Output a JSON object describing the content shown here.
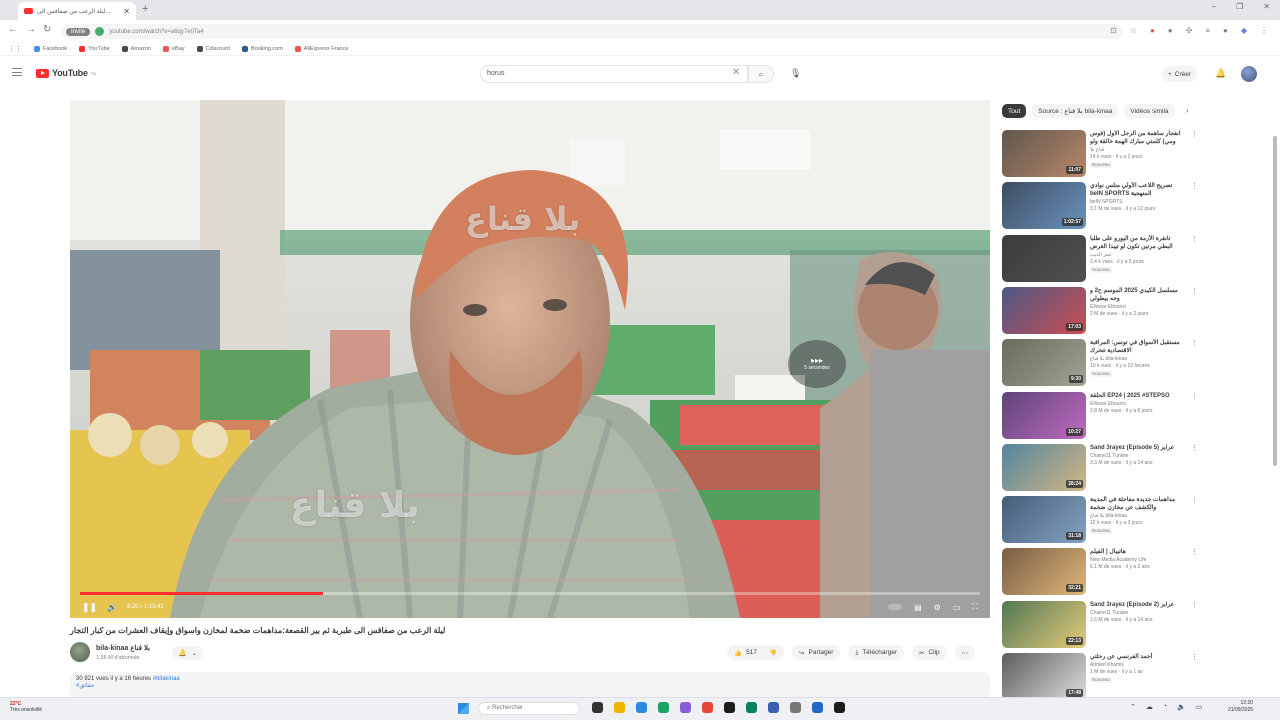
{
  "browser": {
    "tab_title": "ليلة الرعب من صفاقس الى...",
    "url": "youtube.com/watch?v=a6qy7e0Ta4",
    "incognito_badge": "Invité",
    "window_controls": [
      "–",
      "❐",
      "✕"
    ],
    "bookmarks": [
      {
        "label": "Facebook",
        "color": "#1877f2"
      },
      {
        "label": "YouTube",
        "color": "#ff0000"
      },
      {
        "label": "Amazon",
        "color": "#222222"
      },
      {
        "label": "eBay",
        "color": "#e53238"
      },
      {
        "label": "Cdiscount",
        "color": "#222222"
      },
      {
        "label": "Booking.com",
        "color": "#003580"
      },
      {
        "label": "AliExpress France",
        "color": "#e43225"
      }
    ]
  },
  "header": {
    "logo_text": "YouTube",
    "logo_region": "TN",
    "search_value": "horus",
    "create_label": "Créer"
  },
  "video": {
    "watermark": "بلا قناع",
    "time": "6:20 / 1:13:41",
    "progress": 0.27,
    "skip_label": "5 secondes",
    "title": "ليلة الرعب من صفاقس الى طبربة ثم بير القصعة:مداهمات ضخمة لمخازن واسواق وإيقاف العشرات من كبار التجار"
  },
  "channel": {
    "name": "bila-kinaa بلا قناع",
    "subscribers": "1,56 M d'abonnés"
  },
  "actions": {
    "likes": "517",
    "share": "Partager",
    "download": "Télécharger",
    "clip": "Clip"
  },
  "description": {
    "stats": "30 821 vues  il y a 16 heures",
    "hashtag1": "#bilakinaa",
    "hashtag2": "#حقائق"
  },
  "sidebar": {
    "filters": [
      "Tout",
      "Source : بلا قناع bila-kinaa",
      "Vidéos simila"
    ],
    "recommendations": [
      {
        "title": "انفجار ساهمة من الرجل الاول (فوس ومي) كلمتي مبارك الهمة خالقة ولو اتحملو...",
        "channel": "قناع بلا",
        "views": "14 k vues · il y a 2 jours",
        "badge": "Nouveau",
        "duration": "11:07",
        "bg1": "#3d3226",
        "bg2": "#a86e4a"
      },
      {
        "title": "تصريح اللاعب الأولي منلس نوادي beIN SPORTS المنهجية",
        "channel": "beIN SPORTS",
        "views": "3,1 M de vues · il y a 12 jours",
        "badge": "",
        "duration": "1:02:57",
        "bg1": "#14263d",
        "bg2": "#4a7cb3"
      },
      {
        "title": "تانقرة الأزمة من اليورو على طلبا البطي مرتين تكون لو تيبدا الغرض المنوبة",
        "channel": "عمر الديب",
        "views": "2,4 k vues · il y a 5 jours",
        "badge": "Nouveau",
        "duration": "",
        "bg1": "#111111",
        "bg2": "#2b2b2b"
      },
      {
        "title": "مسلسل الكيدي 2025 الموسم ح2 و وجه بيطولي",
        "channel": "Elhiwar Ettounsi",
        "views": "2 M de vues · il y a 2 jours",
        "badge": "",
        "duration": "17:03",
        "bg1": "#24346c",
        "bg2": "#c2272d"
      },
      {
        "title": "مستقبل الأسواق في تونس: المراقبة الاقتصادية تتحرك",
        "channel": "بلا قناع bila-kinaa",
        "views": "19 k vues · il y a 23 heures",
        "badge": "Nouveau",
        "duration": "9:30",
        "bg1": "#4a4a3a",
        "bg2": "#8d8f7d"
      },
      {
        "title": "الحلقة EP24 | 2025 #STEPSO",
        "channel": "Elhiwar Ettounsi",
        "views": "2,8 M de vues · il y a 6 jours",
        "badge": "",
        "duration": "10:27",
        "bg1": "#3a1c5c",
        "bg2": "#b34ab3"
      },
      {
        "title": "Sand 3rayez (Episode 5) عرايز",
        "channel": "Chaine11 Tunisie",
        "views": "3,3 M de vues · il y a 14 ans",
        "badge": "",
        "duration": "28:24",
        "bg1": "#2e6a8a",
        "bg2": "#c8a86a"
      },
      {
        "title": "مداهمات جديدة مفاجئة في المدينة والكشف عن مخازن ضخمة",
        "channel": "بلا قناع bila-kinaa",
        "views": "12 k vues · il y a 3 jours",
        "badge": "Nouveau",
        "duration": "31:18",
        "bg1": "#1c3a5c",
        "bg2": "#6a8fb3"
      },
      {
        "title": "هاتيبال | الفيلم",
        "channel": "New Media Academy Life",
        "views": "6,1 M de vues · il y a 2 ans",
        "badge": "",
        "duration": "32:21",
        "bg1": "#5c3a1c",
        "bg2": "#d9a85a"
      },
      {
        "title": "Sand 3rayez (Episode 2) عرايز",
        "channel": "Chaine11 Tunisie",
        "views": "1,6 M de vues · il y a 14 ans",
        "badge": "",
        "duration": "22:13",
        "bg1": "#2b5a2b",
        "bg2": "#e0c060"
      },
      {
        "title": "أحمد الفرنسي عن رحلتي",
        "channel": "Ahmed Khamis",
        "views": "1 M de vues · il y a 1 an",
        "badge": "Nouveau",
        "duration": "17:48",
        "bg1": "#3a3a3a",
        "bg2": "#d8d8d8"
      }
    ]
  },
  "taskbar": {
    "weather_temp": "22°C",
    "weather_label": "Très ensoleillé",
    "search_placeholder": "Rechercher",
    "time": "12:20",
    "date": "21/09/2025",
    "app_colors": [
      "#333333",
      "#f0b400",
      "#2b8be3",
      "#1ea362",
      "#8a5cd6",
      "#e8463a",
      "#1c1c1c",
      "#0a7f5a",
      "#3b5fb0",
      "#777777",
      "#2466c8",
      "#1c1c1c"
    ]
  }
}
